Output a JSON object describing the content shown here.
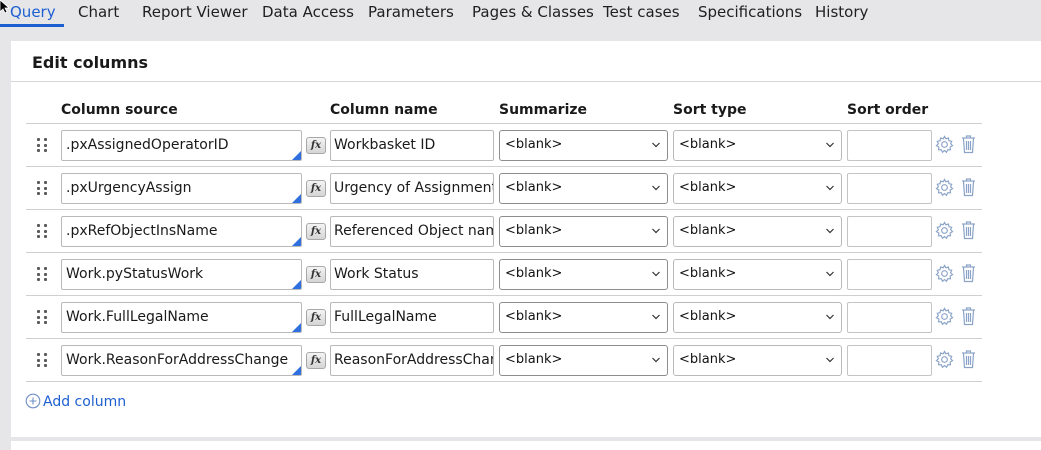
{
  "tabs": [
    {
      "label": "Query",
      "active": true
    },
    {
      "label": "Chart"
    },
    {
      "label": "Report Viewer"
    },
    {
      "label": "Data Access"
    },
    {
      "label": "Parameters"
    },
    {
      "label": "Pages & Classes"
    },
    {
      "label": "Test cases"
    },
    {
      "label": "Specifications"
    },
    {
      "label": "History"
    }
  ],
  "panel": {
    "title": "Edit columns",
    "headers": {
      "column_source": "Column source",
      "column_name": "Column name",
      "summarize": "Summarize",
      "sort_type": "Sort type",
      "sort_order": "Sort order"
    },
    "rows": [
      {
        "source": ".pxAssignedOperatorID",
        "name": "Workbasket ID",
        "summarize": "<blank>",
        "sort_type": "<blank>",
        "sort_order": ""
      },
      {
        "source": ".pxUrgencyAssign",
        "name": "Urgency of Assignment",
        "summarize": "<blank>",
        "sort_type": "<blank>",
        "sort_order": ""
      },
      {
        "source": ".pxRefObjectInsName",
        "name": "Referenced Object name",
        "summarize": "<blank>",
        "sort_type": "<blank>",
        "sort_order": ""
      },
      {
        "source": "Work.pyStatusWork",
        "name": "Work Status",
        "summarize": "<blank>",
        "sort_type": "<blank>",
        "sort_order": ""
      },
      {
        "source": "Work.FullLegalName",
        "name": "FullLegalName",
        "summarize": "<blank>",
        "sort_type": "<blank>",
        "sort_order": ""
      },
      {
        "source": "Work.ReasonForAddressChange",
        "name": "ReasonForAddressChange",
        "summarize": "<blank>",
        "sort_type": "<blank>",
        "sort_order": ""
      }
    ],
    "fx_label": "fx",
    "add_column_label": "Add column"
  },
  "colors": {
    "accent": "#1c5fd1",
    "background": "#e6e6e9",
    "icon_gray": "#8aa3c7"
  }
}
